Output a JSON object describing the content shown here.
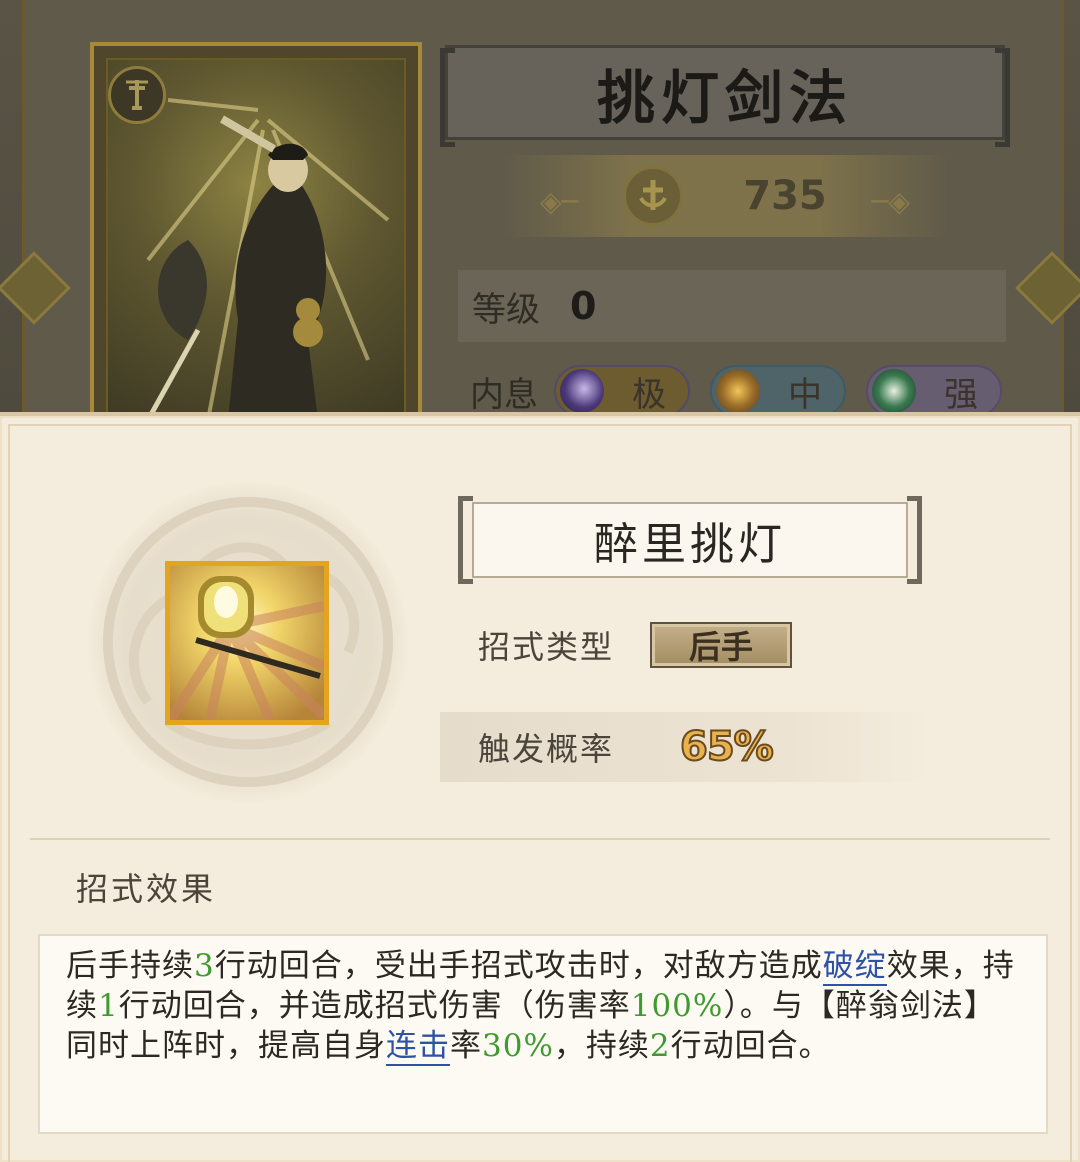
{
  "card_view": {
    "title": "挑灯剑法",
    "power": "735",
    "level_label": "等级",
    "level_value": "0",
    "inner_label": "内息",
    "inner_tags": [
      {
        "text": "极",
        "color": "purple"
      },
      {
        "text": "中",
        "color": "blue"
      },
      {
        "text": "强",
        "color": "violet"
      }
    ]
  },
  "skill": {
    "name": "醉里挑灯",
    "icon": "lantern-skill-icon",
    "type_label": "招式类型",
    "type_value": "后手",
    "rate_label": "触发概率",
    "rate_value": "65%",
    "effect_title": "招式效果",
    "effect": {
      "p1": "后手持续",
      "n1": "3",
      "p2": "行动回合，受出手招式攻击时，对敌方造成",
      "link1": "破绽",
      "p3": "效果，持续",
      "n2": "1",
      "p4": "行动回合，并造成招式伤害（伤害率",
      "n3": "100%",
      "p5": "）。与【醉翁剑法】同时上阵时，提高自身",
      "link2": "连击",
      "p6": "率",
      "n4": "30%",
      "p7": "，持续",
      "n5": "2",
      "p8": "行动回合。"
    }
  },
  "colors": {
    "panel_bg": "#f4ecdc",
    "green_number": "#3f9a2f",
    "link_blue": "#2e52a6",
    "rate_gold": "#e9b24a"
  }
}
